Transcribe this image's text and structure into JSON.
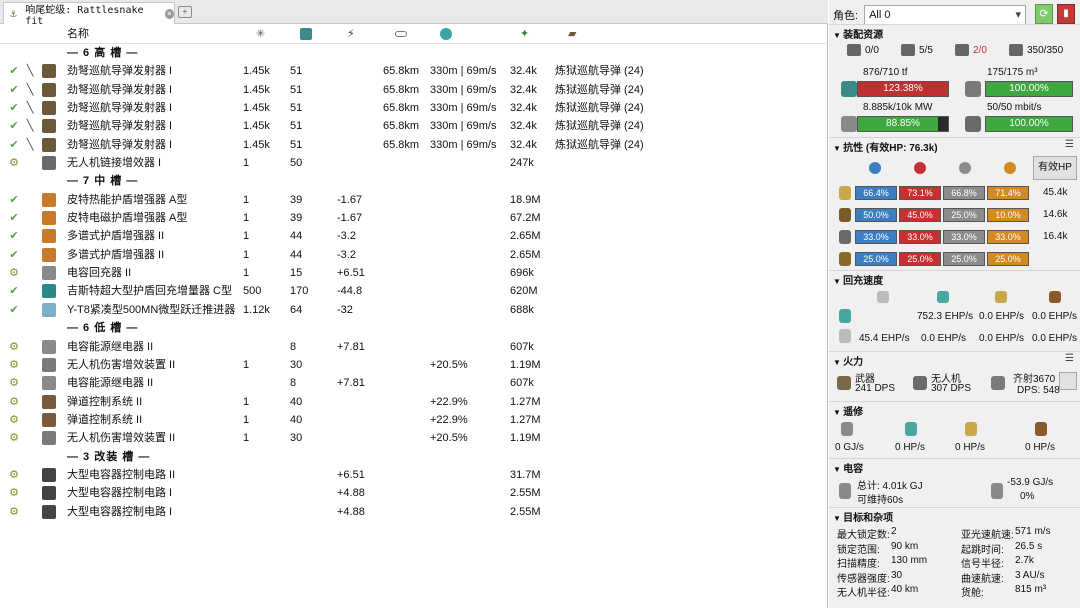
{
  "tab": {
    "title": "响尾蛇级: Rattlesnake fit"
  },
  "table": {
    "headers": {
      "name": "名称"
    },
    "rows": [
      {
        "type": "section",
        "label": "— 6 高 槽 —"
      },
      {
        "type": "mod",
        "state": "✔",
        "charge": "╲",
        "icon": "missile",
        "name": "劲弩巡航导弹发射器 I",
        "cpu": "1.45k",
        "pg": "51",
        "cap": "",
        "opt": "65.8km",
        "fall": "330m | 69m/s",
        "dmg": "32.4k",
        "price": "炼狱巡航导弹 (24)"
      },
      {
        "type": "mod",
        "state": "✔",
        "charge": "╲",
        "icon": "missile",
        "name": "劲弩巡航导弹发射器 I",
        "cpu": "1.45k",
        "pg": "51",
        "cap": "",
        "opt": "65.8km",
        "fall": "330m | 69m/s",
        "dmg": "32.4k",
        "price": "炼狱巡航导弹 (24)"
      },
      {
        "type": "mod",
        "state": "✔",
        "charge": "╲",
        "icon": "missile",
        "name": "劲弩巡航导弹发射器 I",
        "cpu": "1.45k",
        "pg": "51",
        "cap": "",
        "opt": "65.8km",
        "fall": "330m | 69m/s",
        "dmg": "32.4k",
        "price": "炼狱巡航导弹 (24)"
      },
      {
        "type": "mod",
        "state": "✔",
        "charge": "╲",
        "icon": "missile",
        "name": "劲弩巡航导弹发射器 I",
        "cpu": "1.45k",
        "pg": "51",
        "cap": "",
        "opt": "65.8km",
        "fall": "330m | 69m/s",
        "dmg": "32.4k",
        "price": "炼狱巡航导弹 (24)"
      },
      {
        "type": "mod",
        "state": "✔",
        "charge": "╲",
        "icon": "missile",
        "name": "劲弩巡航导弹发射器 I",
        "cpu": "1.45k",
        "pg": "51",
        "cap": "",
        "opt": "65.8km",
        "fall": "330m | 69m/s",
        "dmg": "32.4k",
        "price": "炼狱巡航导弹 (24)"
      },
      {
        "type": "mod",
        "state": "⚙",
        "charge": "",
        "icon": "drone",
        "name": "无人机链接增效器 I",
        "cpu": "1",
        "pg": "50",
        "cap": "",
        "opt": "",
        "fall": "",
        "dmg": "247k",
        "price": ""
      },
      {
        "type": "section",
        "label": "— 7 中 槽 —"
      },
      {
        "type": "mod",
        "state": "✔",
        "charge": "",
        "icon": "shield",
        "name": "皮特热能护盾增强器 A型",
        "cpu": "1",
        "pg": "39",
        "cap": "-1.67",
        "opt": "",
        "fall": "",
        "dmg": "18.9M",
        "price": ""
      },
      {
        "type": "mod",
        "state": "✔",
        "charge": "",
        "icon": "shield",
        "name": "皮特电磁护盾增强器 A型",
        "cpu": "1",
        "pg": "39",
        "cap": "-1.67",
        "opt": "",
        "fall": "",
        "dmg": "67.2M",
        "price": ""
      },
      {
        "type": "mod",
        "state": "✔",
        "charge": "",
        "icon": "shield",
        "name": "多谱式护盾增强器 II",
        "cpu": "1",
        "pg": "44",
        "cap": "-3.2",
        "opt": "",
        "fall": "",
        "dmg": "2.65M",
        "price": ""
      },
      {
        "type": "mod",
        "state": "✔",
        "charge": "",
        "icon": "shield",
        "name": "多谱式护盾增强器 II",
        "cpu": "1",
        "pg": "44",
        "cap": "-3.2",
        "opt": "",
        "fall": "",
        "dmg": "2.65M",
        "price": ""
      },
      {
        "type": "mod",
        "state": "⚙",
        "charge": "",
        "icon": "cap",
        "name": "电容回充器 II",
        "cpu": "1",
        "pg": "15",
        "cap": "+6.51",
        "opt": "",
        "fall": "",
        "dmg": "696k",
        "price": ""
      },
      {
        "type": "mod",
        "state": "✔",
        "charge": "",
        "icon": "booster",
        "name": "吉斯特超大型护盾回充增量器 C型",
        "cpu": "500",
        "pg": "170",
        "cap": "-44.8",
        "opt": "",
        "fall": "",
        "dmg": "620M",
        "price": ""
      },
      {
        "type": "mod",
        "state": "✔",
        "charge": "",
        "icon": "mwd",
        "name": "Y-T8紧凑型500MN微型跃迁推进器",
        "cpu": "1.12k",
        "pg": "64",
        "cap": "-32",
        "opt": "",
        "fall": "",
        "dmg": "688k",
        "price": ""
      },
      {
        "type": "section",
        "label": "— 6 低 槽 —"
      },
      {
        "type": "mod",
        "state": "⚙",
        "charge": "",
        "icon": "cap",
        "name": "电容能源继电器 II",
        "cpu": "",
        "pg": "8",
        "cap": "+7.81",
        "opt": "",
        "fall": "",
        "dmg": "607k",
        "price": ""
      },
      {
        "type": "mod",
        "state": "⚙",
        "charge": "",
        "icon": "dronedmg",
        "name": "无人机伤害增效装置 II",
        "cpu": "1",
        "pg": "30",
        "cap": "",
        "opt": "",
        "fall": "+20.5%",
        "dmg": "1.19M",
        "price": ""
      },
      {
        "type": "mod",
        "state": "⚙",
        "charge": "",
        "icon": "cap",
        "name": "电容能源继电器 II",
        "cpu": "",
        "pg": "8",
        "cap": "+7.81",
        "opt": "",
        "fall": "",
        "dmg": "607k",
        "price": ""
      },
      {
        "type": "mod",
        "state": "⚙",
        "charge": "",
        "icon": "bcs",
        "name": "弹道控制系统 II",
        "cpu": "1",
        "pg": "40",
        "cap": "",
        "opt": "",
        "fall": "+22.9%",
        "dmg": "1.27M",
        "price": ""
      },
      {
        "type": "mod",
        "state": "⚙",
        "charge": "",
        "icon": "bcs",
        "name": "弹道控制系统 II",
        "cpu": "1",
        "pg": "40",
        "cap": "",
        "opt": "",
        "fall": "+22.9%",
        "dmg": "1.27M",
        "price": ""
      },
      {
        "type": "mod",
        "state": "⚙",
        "charge": "",
        "icon": "dronedmg",
        "name": "无人机伤害增效装置 II",
        "cpu": "1",
        "pg": "30",
        "cap": "",
        "opt": "",
        "fall": "+20.5%",
        "dmg": "1.19M",
        "price": ""
      },
      {
        "type": "section",
        "label": "— 3 改装 槽 —"
      },
      {
        "type": "mod",
        "state": "⚙",
        "charge": "",
        "icon": "rig",
        "name": "大型电容器控制电路 II",
        "cpu": "",
        "pg": "",
        "cap": "+6.51",
        "opt": "",
        "fall": "",
        "dmg": "31.7M",
        "price": ""
      },
      {
        "type": "mod",
        "state": "⚙",
        "charge": "",
        "icon": "rig",
        "name": "大型电容器控制电路 I",
        "cpu": "",
        "pg": "",
        "cap": "+4.88",
        "opt": "",
        "fall": "",
        "dmg": "2.55M",
        "price": ""
      },
      {
        "type": "mod",
        "state": "⚙",
        "charge": "",
        "icon": "rig",
        "name": "大型电容器控制电路 I",
        "cpu": "",
        "pg": "",
        "cap": "+4.88",
        "opt": "",
        "fall": "",
        "dmg": "2.55M",
        "price": ""
      }
    ]
  },
  "right": {
    "role_label": "角色:",
    "role_value": "All 0",
    "resources": {
      "title": "装配资源",
      "turrets": "0/0",
      "launchers": "5/5",
      "drones_bay": "2/0",
      "bandwidth_top": "350/350",
      "cpu_text": "876/710 tf",
      "cpu_bar": "123.38%",
      "cpu_fill": 1.0,
      "drone_bay_text": "175/175 m³",
      "drone_bay_bar": "100.00%",
      "drone_bay_fill": 1.0,
      "pg_text": "8.885k/10k MW",
      "pg_bar": "88.85%",
      "pg_fill": 0.8885,
      "bw_text": "50/50 mbit/s",
      "bw_bar": "100.00%",
      "bw_fill": 1.0
    },
    "resist": {
      "title": "抗性 (有效HP: 76.3k)",
      "ehp_btn": "有效HP",
      "rows": [
        {
          "em": "66.4%",
          "th": "73.1%",
          "ki": "66.8%",
          "ex": "71.4%",
          "hp": "45.4k"
        },
        {
          "em": "50.0%",
          "th": "45.0%",
          "ki": "25.0%",
          "ex": "10.0%",
          "hp": "14.6k"
        },
        {
          "em": "33.0%",
          "th": "33.0%",
          "ki": "33.0%",
          "ex": "33.0%",
          "hp": "16.4k"
        },
        {
          "em": "25.0%",
          "th": "25.0%",
          "ki": "25.0%",
          "ex": "25.0%",
          "hp": ""
        }
      ]
    },
    "recharge": {
      "title": "回充速度",
      "row1": [
        "752.3 EHP/s",
        "0.0 EHP/s",
        "0.0 EHP/s"
      ],
      "row2": [
        "45.4 EHP/s",
        "0.0 EHP/s",
        "0.0 EHP/s",
        "0.0 EHP/s"
      ]
    },
    "firepower": {
      "title": "火力",
      "weapon_label": "武器",
      "weapon_dps": "241 DPS",
      "drone_label": "无人机",
      "drone_dps": "307 DPS",
      "volley_label": "齐射3670",
      "total_dps": "DPS: 548"
    },
    "repair": {
      "title": "遥修",
      "values": [
        "0 GJ/s",
        "0 HP/s",
        "0 HP/s",
        "0 HP/s"
      ]
    },
    "capacitor": {
      "title": "电容",
      "total": "总计: 4.01k GJ",
      "lasts": "可维持60s",
      "delta": "-53.9 GJ/s",
      "pct": "0%"
    },
    "targeting": {
      "title": "目标和杂项",
      "left": [
        [
          "最大锁定数:",
          "2"
        ],
        [
          "锁定范围:",
          "90 km"
        ],
        [
          "扫描精度:",
          "130 mm"
        ],
        [
          "传感器强度:",
          "30"
        ],
        [
          "无人机半径:",
          "40 km"
        ]
      ],
      "right": [
        [
          "亚光速航速:",
          "571 m/s"
        ],
        [
          "起跳时间:",
          "26.5 s"
        ],
        [
          "信号半径:",
          "2.7k"
        ],
        [
          "曲速航速:",
          "3 AU/s"
        ],
        [
          "货舱:",
          "815 m³"
        ]
      ]
    }
  }
}
